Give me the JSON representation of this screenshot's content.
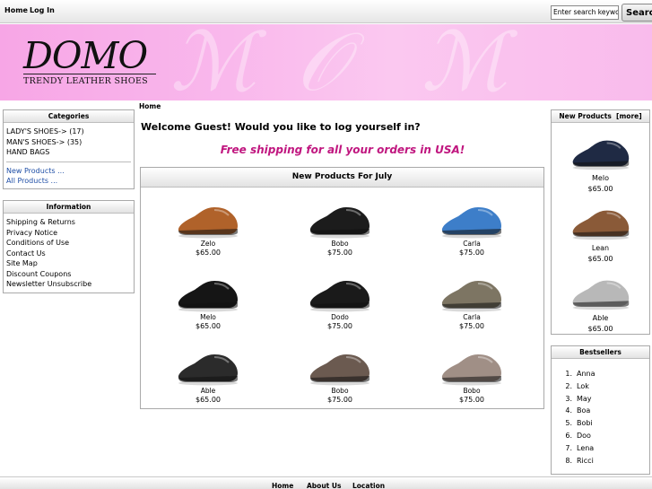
{
  "topnav": {
    "home": "Home",
    "login": "Log In"
  },
  "search": {
    "value": "Enter search keywo",
    "button": "Search"
  },
  "logo": {
    "main": "DOMO",
    "sub": "TRENDY LEATHER SHOES"
  },
  "breadcrumb": "Home",
  "categories": {
    "title": "Categories",
    "items": [
      "LADY'S SHOES-> (17)",
      "MAN'S SHOES-> (35)",
      "HAND BAGS"
    ],
    "links": [
      "New Products ...",
      "All Products ..."
    ]
  },
  "information": {
    "title": "Information",
    "items": [
      "Shipping & Returns",
      "Privacy Notice",
      "Conditions of Use",
      "Contact Us",
      "Site Map",
      "Discount Coupons",
      "Newsletter Unsubscribe"
    ]
  },
  "welcome": "Welcome Guest! Would you like to log yourself in?",
  "promo": "Free shipping for all your orders in USA!",
  "new_products": {
    "title": "New Products For July",
    "items": [
      {
        "name": "Zelo",
        "price": "$65.00",
        "color": "#b0622a"
      },
      {
        "name": "Bobo",
        "price": "$75.00",
        "color": "#1c1c1c"
      },
      {
        "name": "Carla",
        "price": "$75.00",
        "color": "#3d7ec9"
      },
      {
        "name": "Melo",
        "price": "$65.00",
        "color": "#151515"
      },
      {
        "name": "Dodo",
        "price": "$75.00",
        "color": "#1a1a1a"
      },
      {
        "name": "Carla",
        "price": "$75.00",
        "color": "#7d7563"
      },
      {
        "name": "Able",
        "price": "$65.00",
        "color": "#2b2b2b"
      },
      {
        "name": "Bobo",
        "price": "$75.00",
        "color": "#6b5a50"
      },
      {
        "name": "Bobo",
        "price": "$75.00",
        "color": "#a08f86"
      }
    ]
  },
  "right_new": {
    "title": "New Products",
    "more": "[more]",
    "items": [
      {
        "name": "Melo",
        "price": "$65.00",
        "color": "#1f2a44"
      },
      {
        "name": "Lean",
        "price": "$65.00",
        "color": "#8a5a38"
      },
      {
        "name": "Able",
        "price": "$65.00",
        "color": "#b8b8b8"
      }
    ]
  },
  "bestsellers": {
    "title": "Bestsellers",
    "items": [
      "Anna",
      "Lok",
      "May",
      "Boa",
      "Bobi",
      "Doo",
      "Lena",
      "Ricci"
    ]
  },
  "footer": {
    "home": "Home",
    "about": "About Us",
    "location": "Location"
  }
}
